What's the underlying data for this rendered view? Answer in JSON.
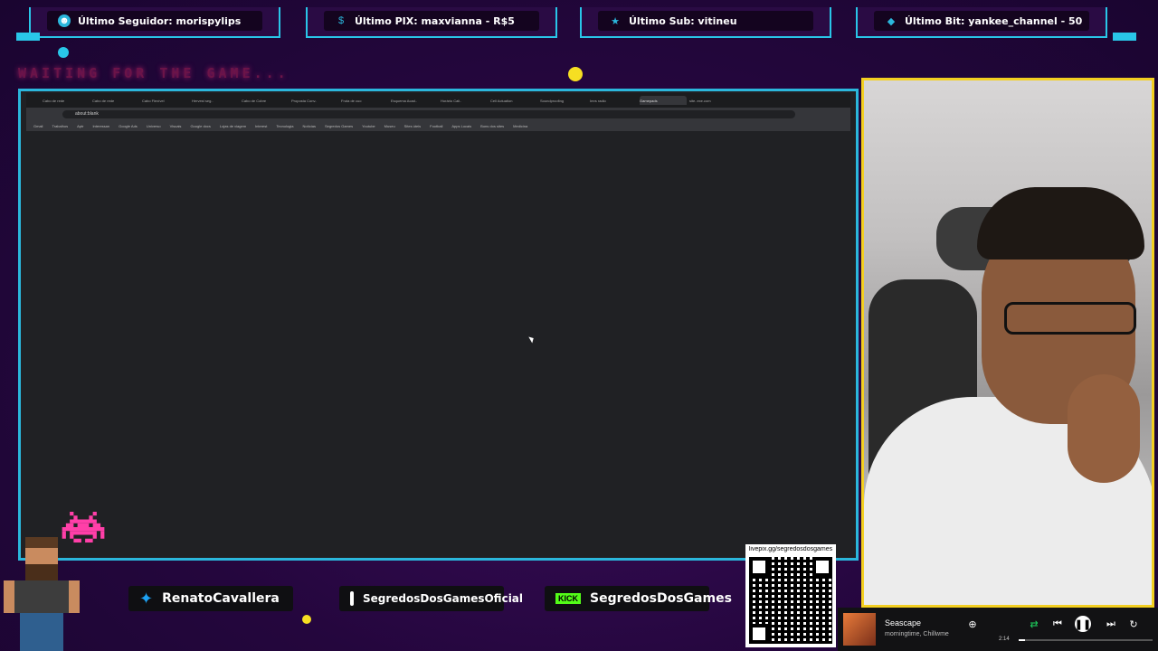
{
  "stats": [
    {
      "label": "Último Seguidor: morispylips",
      "icon": "user-icon",
      "color": "#2bb7dc"
    },
    {
      "label": "Último PIX: maxvianna - R$5",
      "icon": "dollar-icon",
      "color": "#2bb7dc"
    },
    {
      "label": "Último Sub: vitineu",
      "icon": "star-icon",
      "color": "#2bb7dc"
    },
    {
      "label": "Último Bit: yankee_channel - 50",
      "icon": "diamond-icon",
      "color": "#2bb7dc"
    }
  ],
  "waiting_text": "WAITING FOR THE GAME...",
  "browser": {
    "tabs": [
      "Cabo de rede",
      "Cabo de rede",
      "Cabo Flexível",
      "Hervest seg..",
      "Cabo de Cobre",
      "Proposta Conv..",
      "Fruta de cuo",
      "Esquema Acad..",
      "Horário Cali..",
      "Cell Actuation",
      "Soundproofing",
      "Imrs radio",
      "Gamepads",
      "site..exe.com"
    ],
    "active_tab": "Gamepads",
    "address": "about:blank",
    "bookmarks": [
      "Gmail",
      "Trabalhos",
      "Aptr",
      "Interessan",
      "Google Ads",
      "Universo",
      "Visuais",
      "Google docs",
      "Lojas de viagem",
      "Interest",
      "Tecnologia",
      "Notícias",
      "Segredos Games",
      "Youtube",
      "Museu",
      "Sites úteis",
      "Football",
      "Apps Locais",
      "Bons dos sites",
      "Medicina"
    ]
  },
  "socials": [
    {
      "label": "RenatoCavallera",
      "icon": "twitter-icon"
    },
    {
      "label": "SegredosDosGamesOficial",
      "icon": "instagram-icon"
    },
    {
      "label": "SegredosDosGames",
      "icon": "kick-icon",
      "badge": "KICK"
    }
  ],
  "qr": {
    "url": "livepix.gg/segredosdosgames"
  },
  "player": {
    "title": "Seascape",
    "artist": "morningtime, Chillwme",
    "elapsed": "2:14",
    "progress": 0.05
  }
}
